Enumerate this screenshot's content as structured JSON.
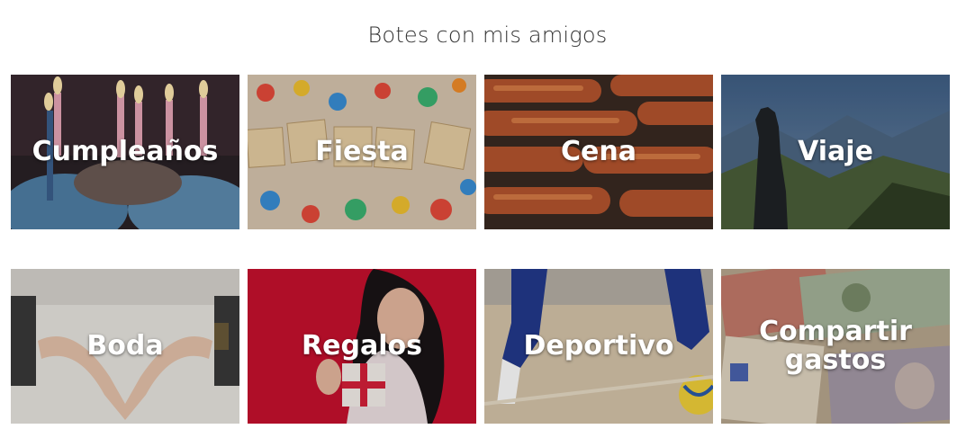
{
  "page": {
    "title": "Botes con mis amigos"
  },
  "tiles": [
    {
      "label": "Cumpleaños",
      "icon": "birthday-cake-image"
    },
    {
      "label": "Fiesta",
      "icon": "party-scrabble-image"
    },
    {
      "label": "Cena",
      "icon": "sausages-grill-image"
    },
    {
      "label": "Viaje",
      "icon": "mountain-traveler-image"
    },
    {
      "label": "Boda",
      "icon": "wedding-hands-heart-image"
    },
    {
      "label": "Regalos",
      "icon": "woman-gift-image"
    },
    {
      "label": "Deportivo",
      "icon": "futsal-ball-image"
    },
    {
      "label": "Compartir gastos",
      "icon": "banknotes-image"
    }
  ],
  "colors": {
    "title": "#333333",
    "label": "#ffffff",
    "gift_bg": "#c8102e"
  }
}
